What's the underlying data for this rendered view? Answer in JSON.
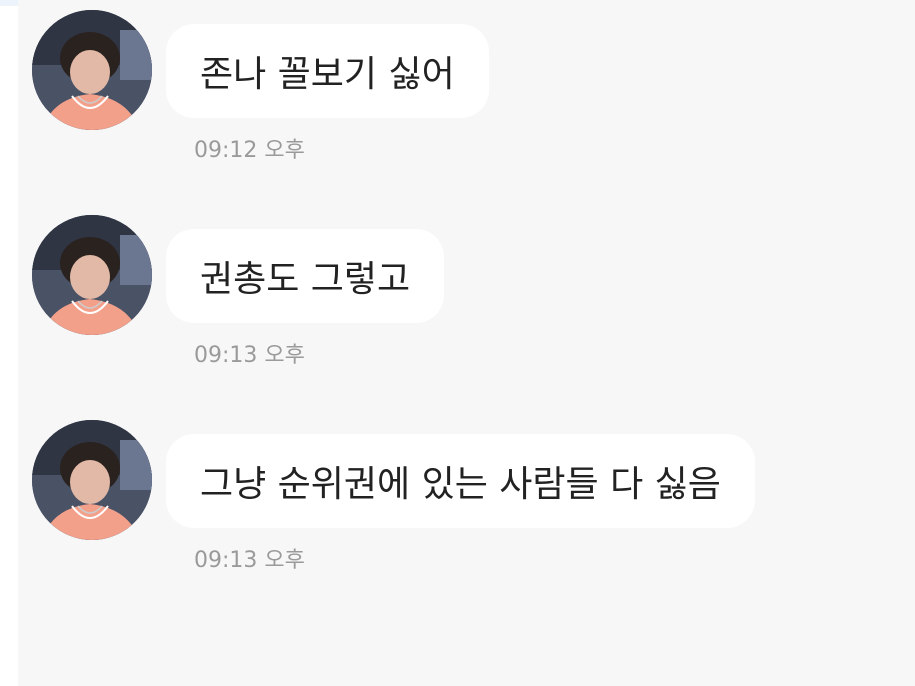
{
  "messages": [
    {
      "text": "존나 꼴보기 싫어",
      "time": "09:12 오후"
    },
    {
      "text": "권총도 그렇고",
      "time": "09:13 오후"
    },
    {
      "text": "그냥 순위권에 있는 사람들 다 싫음",
      "time": "09:13 오후"
    }
  ],
  "colors": {
    "background": "#f7f7f8",
    "bubble": "#ffffff",
    "timestamp": "#9a9a9a"
  },
  "icons": {
    "avatar": "avatar-icon"
  }
}
